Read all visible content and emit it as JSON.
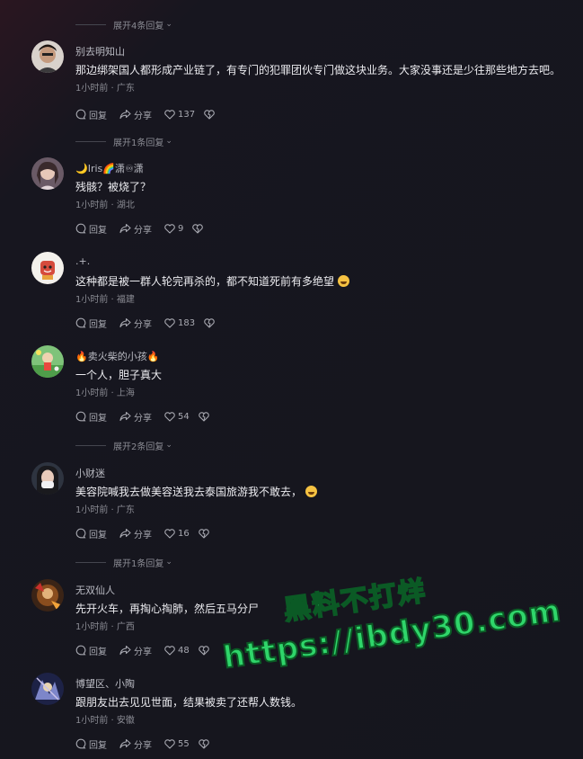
{
  "replies_expanders": [
    {
      "label": "展开4条回复"
    },
    {
      "label": "展开1条回复"
    },
    {
      "label": "展开2条回复"
    },
    {
      "label": "展开1条回复"
    }
  ],
  "action_labels": {
    "reply": "回复",
    "share": "分享"
  },
  "comments": [
    {
      "username": "别去明知山",
      "text": "那边绑架国人都形成产业链了，有专门的犯罪团伙专门做这块业务。大家没事还是少往那些地方去吧。",
      "meta": "1小时前 · 广东",
      "likes": "137"
    },
    {
      "username": "🌙Iris🌈潇♾潇",
      "text": "残骸？被烧了？",
      "meta": "1小时前 · 湖北",
      "likes": "9"
    },
    {
      "username": ".+.",
      "text": "这种都是被一群人轮完再杀的，都不知道死前有多绝望",
      "meta": "1小时前 · 福建",
      "likes": "183"
    },
    {
      "username": "🔥卖火柴的小孩🔥",
      "text": "一个人，胆子真大",
      "meta": "1小时前 · 上海",
      "likes": "54"
    },
    {
      "username": "小财迷",
      "text": "美容院喊我去做美容送我去泰国旅游我不敢去，",
      "meta": "1小时前 · 广东",
      "likes": "16"
    },
    {
      "username": "无双仙人",
      "text": "先开火车，再掏心掏肺，然后五马分尸",
      "meta": "1小时前 · 广西",
      "likes": "48"
    },
    {
      "username": "博望区、小陶",
      "text": "跟朋友出去见见世面，结果被卖了还帮人数钱。",
      "meta": "1小时前 · 安徽",
      "likes": "55"
    }
  ],
  "watermark": {
    "line1": "黑料不打烊",
    "line2": "https://ibdy30.com"
  }
}
